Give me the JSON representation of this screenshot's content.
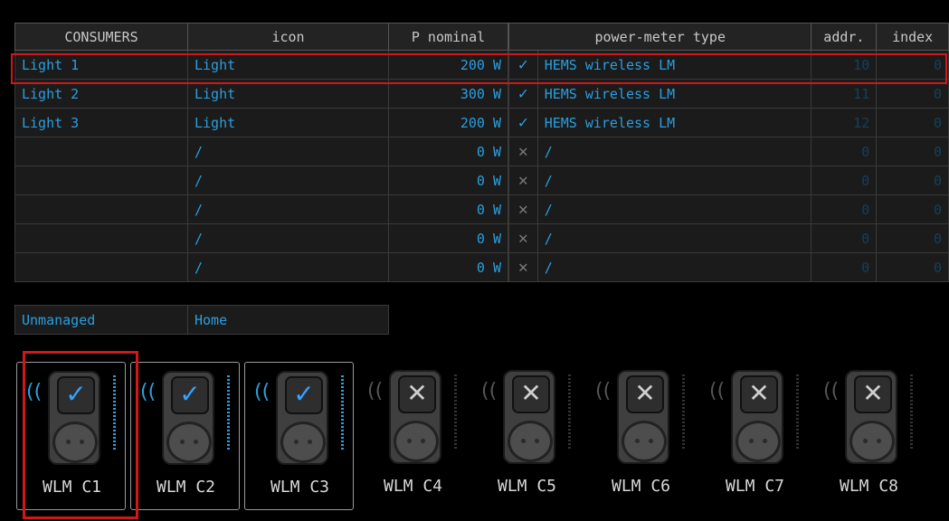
{
  "consumers_table": {
    "headers": {
      "consumers": "CONSUMERS",
      "icon": "icon",
      "p_nominal": "P nominal"
    },
    "rows": [
      {
        "name": "Light 1",
        "icon": "Light",
        "power": "200 W"
      },
      {
        "name": "Light 2",
        "icon": "Light",
        "power": "300 W"
      },
      {
        "name": "Light 3",
        "icon": "Light",
        "power": "200 W"
      },
      {
        "name": "",
        "icon": "/",
        "power": "0 W"
      },
      {
        "name": "",
        "icon": "/",
        "power": "0 W"
      },
      {
        "name": "",
        "icon": "/",
        "power": "0 W"
      },
      {
        "name": "",
        "icon": "/",
        "power": "0 W"
      },
      {
        "name": "",
        "icon": "/",
        "power": "0 W"
      }
    ],
    "unmanaged_label": "Unmanaged",
    "unmanaged_icon": "Home"
  },
  "meter_table": {
    "headers": {
      "type": "power-meter type",
      "addr": "addr.",
      "index": "index"
    },
    "rows": [
      {
        "status": "✓",
        "ok": true,
        "type": "HEMS wireless LM",
        "addr": "10",
        "index": "0"
      },
      {
        "status": "✓",
        "ok": true,
        "type": "HEMS wireless LM",
        "addr": "11",
        "index": "0"
      },
      {
        "status": "✓",
        "ok": true,
        "type": "HEMS wireless LM",
        "addr": "12",
        "index": "0"
      },
      {
        "status": "✕",
        "ok": false,
        "type": "/",
        "addr": "0",
        "index": "0"
      },
      {
        "status": "✕",
        "ok": false,
        "type": "/",
        "addr": "0",
        "index": "0"
      },
      {
        "status": "✕",
        "ok": false,
        "type": "/",
        "addr": "0",
        "index": "0"
      },
      {
        "status": "✕",
        "ok": false,
        "type": "/",
        "addr": "0",
        "index": "0"
      },
      {
        "status": "✕",
        "ok": false,
        "type": "/",
        "addr": "0",
        "index": "0"
      }
    ]
  },
  "devices": [
    {
      "label": "WLM C1",
      "mark": "✓",
      "ok": true,
      "icon": "socket-plug-icon",
      "selected": true
    },
    {
      "label": "WLM C2",
      "mark": "✓",
      "ok": true,
      "icon": "socket-plug-icon",
      "selected": true
    },
    {
      "label": "WLM C3",
      "mark": "✓",
      "ok": true,
      "icon": "socket-plug-icon",
      "selected": true
    },
    {
      "label": "WLM C4",
      "mark": "✕",
      "ok": false,
      "icon": "socket-plug-icon",
      "selected": false
    },
    {
      "label": "WLM C5",
      "mark": "✕",
      "ok": false,
      "icon": "socket-plug-icon",
      "selected": false
    },
    {
      "label": "WLM C6",
      "mark": "✕",
      "ok": false,
      "icon": "socket-plug-icon",
      "selected": false
    },
    {
      "label": "WLM C7",
      "mark": "✕",
      "ok": false,
      "icon": "socket-plug-icon",
      "selected": false
    },
    {
      "label": "WLM C8",
      "mark": "✕",
      "ok": false,
      "icon": "socket-plug-icon",
      "selected": false
    }
  ],
  "colors": {
    "accent": "#2a9fe0",
    "highlight": "#d01818",
    "background": "#000000"
  }
}
